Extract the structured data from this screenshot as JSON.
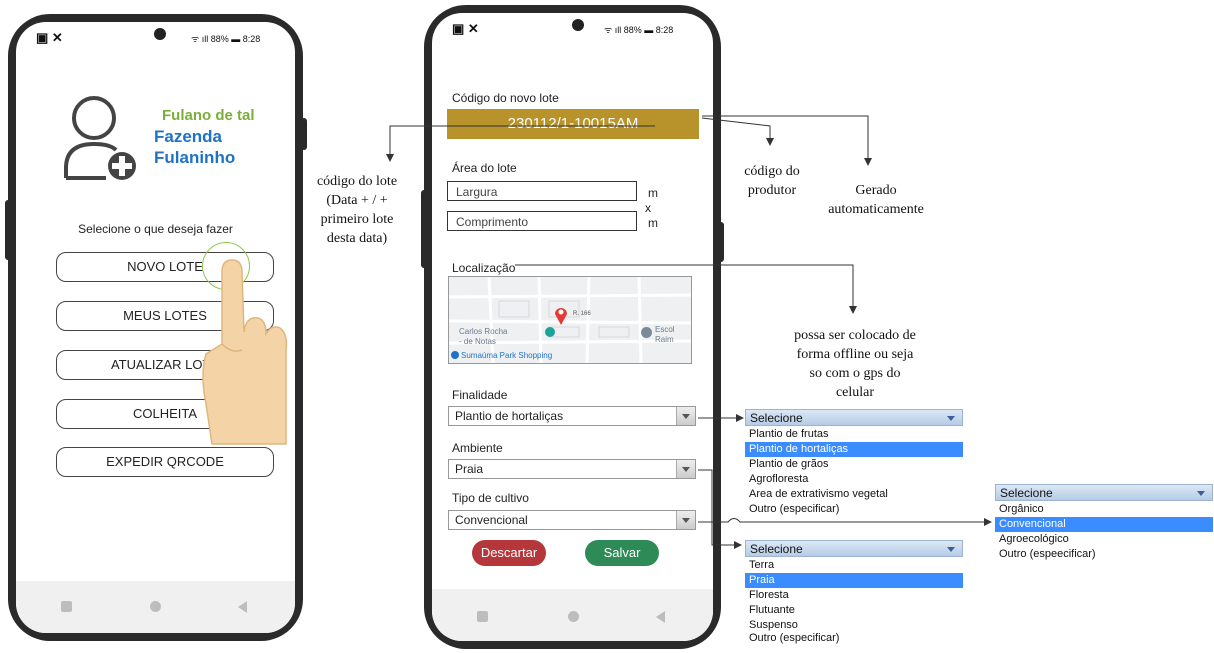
{
  "status": {
    "battery": "88%",
    "time": "8:28"
  },
  "home": {
    "user_name": "Fulano de tal",
    "farm_line1": "Fazenda",
    "farm_line2": "Fulaninho",
    "prompt": "Selecione o que deseja fazer",
    "buttons": [
      "NOVO LOTE",
      "MEUS LOTES",
      "ATUALIZAR LOTE",
      "COLHEITA",
      "EXPEDIR QRCODE"
    ]
  },
  "form": {
    "code_label": "Código do novo lote",
    "code_value": "230112/1-10015AM",
    "area_label": "Área do lote",
    "width_placeholder": "Largura",
    "length_placeholder": "Comprimento",
    "unit_m": "m",
    "times": "x",
    "location_label": "Localização",
    "map": {
      "pin_label": "R. 166",
      "place1_a": "Carlos Rocha",
      "place1_b": "- de Notas",
      "place2_a": "Escol",
      "place2_b": "Raim",
      "place3": "Sumaúma Park Shopping"
    },
    "purpose_label": "Finalidade",
    "purpose_value": "Plantio de hortaliças",
    "environment_label": "Ambiente",
    "environment_value": "Praia",
    "cultivation_label": "Tipo de cultivo",
    "cultivation_value": "Convencional",
    "discard": "Descartar",
    "save": "Salvar"
  },
  "annotations": {
    "lot_code": "código do lote (Data + / + primeiro lote desta data)",
    "producer_code": "código do produtor",
    "auto_generated": "Gerado automaticamente",
    "offline_gps": "possa ser colocado de forma offline ou seja so com o gps do celular"
  },
  "dropdowns": {
    "purpose": {
      "header": "Selecione",
      "options": [
        "Plantio de frutas",
        "Plantio de hortaliças",
        "Plantio de grãos",
        "Agrofloresta",
        "Area de extrativismo vegetal",
        "Outro (especificar)"
      ],
      "selected": 1
    },
    "environment": {
      "header": "Selecione",
      "options": [
        "Terra",
        "Praia",
        "Floresta",
        "Flutuante",
        "Suspenso",
        "Outro (especificar)"
      ],
      "selected": 1
    },
    "cultivation": {
      "header": "Selecione",
      "options": [
        "Orgânico",
        "Convencional",
        "Agroecológico",
        "Outro (espeecificar)"
      ],
      "selected": 1
    }
  },
  "colors": {
    "code_bar": "#b8922b",
    "discard": "#b5373b",
    "save": "#2e8a57",
    "user_name": "#7ab03a",
    "farm": "#1f73c6",
    "selected": "#3b8cff"
  }
}
